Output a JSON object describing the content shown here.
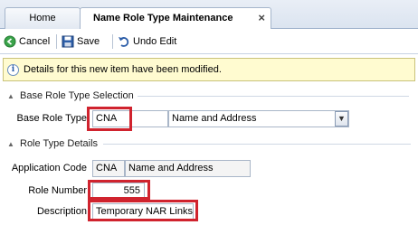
{
  "tabs": {
    "home": "Home",
    "active": "Name Role Type Maintenance"
  },
  "toolbar": {
    "cancel": "Cancel",
    "save": "Save",
    "undo": "Undo Edit"
  },
  "banner": {
    "message": "Details for this new item have been modified."
  },
  "sections": {
    "base": "Base Role Type Selection",
    "details": "Role Type Details"
  },
  "base_role_type": {
    "label": "Base Role Type",
    "code": "CNA",
    "description": "Name and Address"
  },
  "application_code": {
    "label": "Application Code",
    "code": "CNA",
    "description": "Name and Address"
  },
  "role_number": {
    "label": "Role Number",
    "value": "555"
  },
  "description": {
    "label": "Description",
    "value": "Temporary NAR Links"
  },
  "colors": {
    "highlight": "#d0232e",
    "banner_bg": "#fffbd0",
    "accent": "#2a5da8"
  }
}
